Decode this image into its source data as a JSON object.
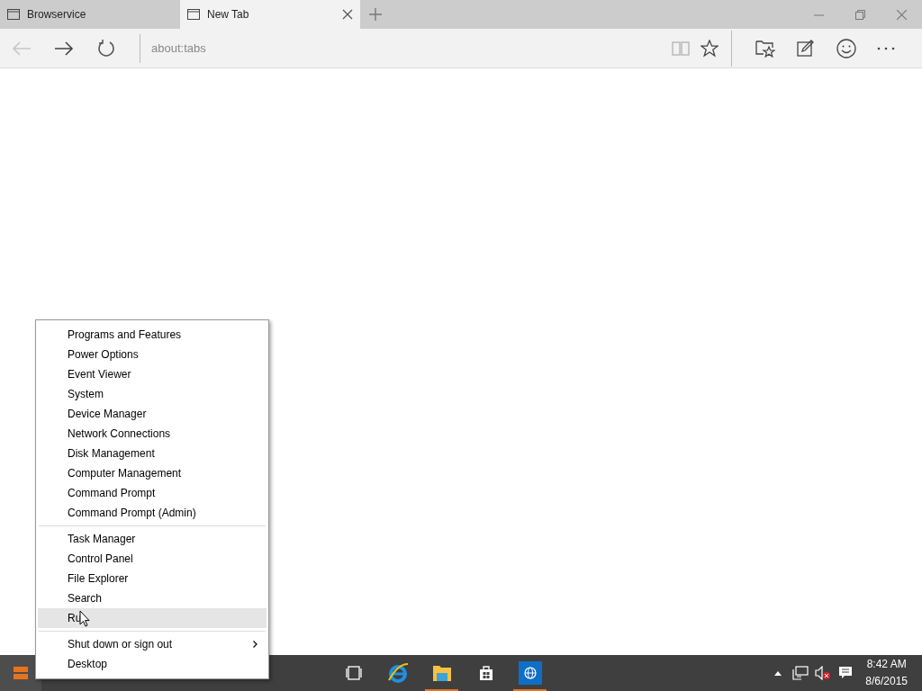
{
  "tabs": [
    {
      "label": "Browservice",
      "selected": false
    },
    {
      "label": "New Tab",
      "selected": true
    }
  ],
  "address": {
    "value": "about:tabs"
  },
  "context_menu": {
    "groups": [
      {
        "items": [
          {
            "label": "Programs and Features",
            "selected": false
          },
          {
            "label": "Power Options",
            "selected": false
          },
          {
            "label": "Event Viewer",
            "selected": false
          },
          {
            "label": "System",
            "selected": false
          },
          {
            "label": "Device Manager",
            "selected": false
          },
          {
            "label": "Network Connections",
            "selected": false
          },
          {
            "label": "Disk Management",
            "selected": false
          },
          {
            "label": "Computer Management",
            "selected": false
          },
          {
            "label": "Command Prompt",
            "selected": false
          },
          {
            "label": "Command Prompt (Admin)",
            "selected": false
          }
        ]
      },
      {
        "items": [
          {
            "label": "Task Manager",
            "selected": false
          },
          {
            "label": "Control Panel",
            "selected": false
          },
          {
            "label": "File Explorer",
            "selected": false
          },
          {
            "label": "Search",
            "selected": false
          },
          {
            "label": "Ru",
            "selected": true
          }
        ]
      },
      {
        "items": [
          {
            "label": "Shut down or sign out",
            "selected": false,
            "submenu": true
          },
          {
            "label": "Desktop",
            "selected": false
          }
        ]
      }
    ]
  },
  "taskbar": {
    "apps": [
      {
        "kind": "taskview",
        "running": false,
        "active": false
      },
      {
        "kind": "ie",
        "running": false,
        "active": false
      },
      {
        "kind": "explorer",
        "running": true,
        "active": false
      },
      {
        "kind": "store",
        "running": false,
        "active": false
      },
      {
        "kind": "globe",
        "running": true,
        "active": true
      }
    ],
    "clock": {
      "time": "8:42 AM",
      "date": "8/6/2015"
    }
  }
}
